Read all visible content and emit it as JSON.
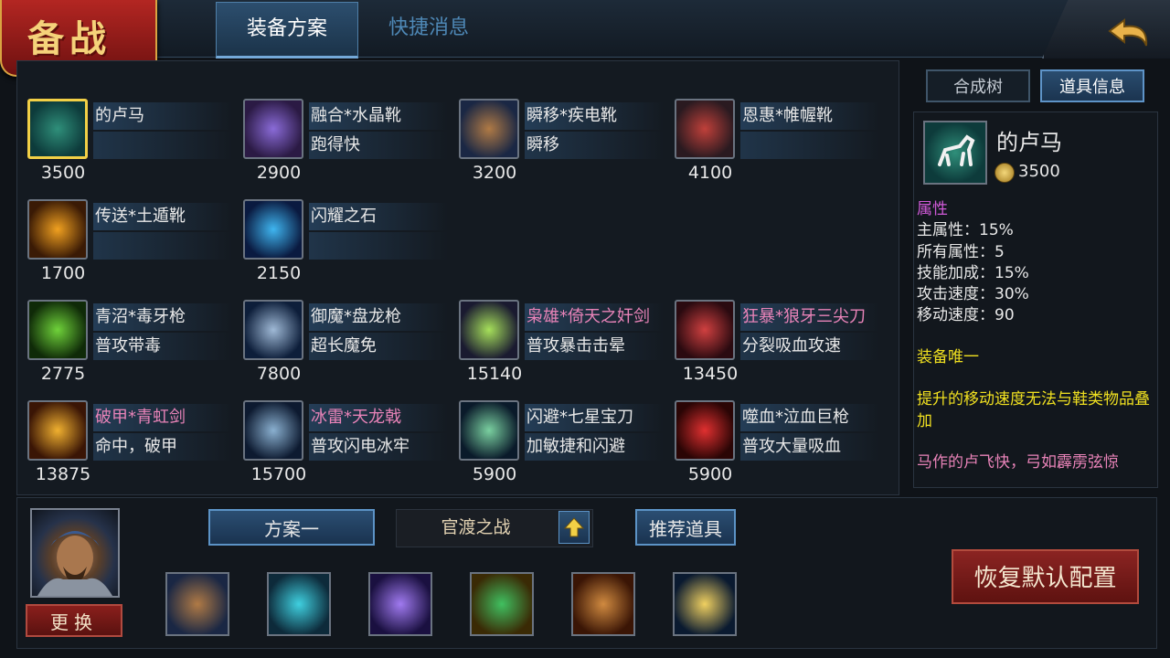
{
  "header": {
    "title": "备战",
    "tabs": [
      "装备方案",
      "快捷消息"
    ]
  },
  "items": [
    {
      "name": "的卢马",
      "desc": "",
      "price": "3500",
      "pink": false,
      "selected": true,
      "icon": "horse-icon",
      "colors": [
        "#0d3b3b",
        "#2f8f7a"
      ]
    },
    {
      "name": "融合*水晶靴",
      "desc": "跑得快",
      "price": "2900",
      "pink": false,
      "selected": false,
      "icon": "crystal-boots-icon",
      "colors": [
        "#2b1a44",
        "#8a6bd8"
      ]
    },
    {
      "name": "瞬移*疾电靴",
      "desc": "瞬移",
      "price": "3200",
      "pink": false,
      "selected": false,
      "icon": "lightning-boots-icon",
      "colors": [
        "#1a2744",
        "#b07a45"
      ]
    },
    {
      "name": "恩惠*帷幄靴",
      "desc": "",
      "price": "4100",
      "pink": false,
      "selected": false,
      "icon": "red-boots-icon",
      "colors": [
        "#2a1a20",
        "#c0403a"
      ]
    },
    {
      "name": "传送*土遁靴",
      "desc": "",
      "price": "1700",
      "pink": false,
      "selected": false,
      "icon": "fire-boots-icon",
      "colors": [
        "#3a1a05",
        "#f0a020"
      ]
    },
    {
      "name": "闪耀之石",
      "desc": "",
      "price": "2150",
      "pink": false,
      "selected": false,
      "icon": "blue-gem-icon",
      "colors": [
        "#0a1a40",
        "#3fb5f0"
      ]
    },
    {
      "name": "青沼*毒牙枪",
      "desc": "普攻带毒",
      "price": "2775",
      "pink": false,
      "selected": false,
      "icon": "poison-spear-icon",
      "colors": [
        "#0f2a08",
        "#6fd23a"
      ]
    },
    {
      "name": "御魔*盘龙枪",
      "desc": "超长魔免",
      "price": "7800",
      "pink": false,
      "selected": false,
      "icon": "dragon-spear-icon",
      "colors": [
        "#0d1e3a",
        "#9fb9d6"
      ]
    },
    {
      "name": "枭雄*倚天之奸剑",
      "desc": "普攻暴击击晕",
      "price": "15140",
      "pink": true,
      "selected": false,
      "icon": "green-sword-icon",
      "colors": [
        "#1a1a30",
        "#a6e05a"
      ]
    },
    {
      "name": "狂暴*狼牙三尖刀",
      "desc": "分裂吸血攻速",
      "price": "13450",
      "pink": true,
      "selected": false,
      "icon": "trident-blade-icon",
      "colors": [
        "#2a0a10",
        "#d04040"
      ]
    },
    {
      "name": "破甲*青虹剑",
      "desc": "命中，破甲",
      "price": "13875",
      "pink": true,
      "selected": false,
      "icon": "golden-sword-icon",
      "colors": [
        "#3a1505",
        "#f0b030"
      ]
    },
    {
      "name": "冰雷*天龙戟",
      "desc": "普攻闪电冰牢",
      "price": "15700",
      "pink": true,
      "selected": false,
      "icon": "halberd-icon",
      "colors": [
        "#0d1a30",
        "#8ab0d0"
      ]
    },
    {
      "name": "闪避*七星宝刀",
      "desc": "加敏捷和闪避",
      "price": "5900",
      "pink": false,
      "selected": false,
      "icon": "seven-star-blade-icon",
      "colors": [
        "#0a1a2a",
        "#7ad0a0"
      ]
    },
    {
      "name": "噬血*泣血巨枪",
      "desc": "普攻大量吸血",
      "price": "5900",
      "pink": false,
      "selected": false,
      "icon": "blood-spear-icon",
      "colors": [
        "#2a0505",
        "#e03030"
      ]
    }
  ],
  "right": {
    "tabs": {
      "tree": "合成树",
      "info": "道具信息"
    },
    "detail": {
      "name": "的卢马",
      "price": "3500",
      "attr_title": "属性",
      "attrs": [
        "主属性：15%",
        "所有属性：5",
        "技能加成：15%",
        "攻击速度：30%",
        "移动速度：90"
      ],
      "unique": "装备唯一",
      "note_line1": "提升的移动速度无法与鞋类物品叠",
      "note_line2": "加",
      "flavor": "马作的卢飞快，弓如霹雳弦惊"
    }
  },
  "bottom": {
    "change": "更换",
    "plan": "方案一",
    "map": "官渡之战",
    "recommend": "推荐道具",
    "restore": "恢复默认配置",
    "slots": [
      {
        "icon": "boots-slot-icon",
        "colors": [
          "#1a2744",
          "#b07a45"
        ]
      },
      {
        "icon": "crystal-armor-slot-icon",
        "colors": [
          "#0d2a3a",
          "#3fd0e0"
        ]
      },
      {
        "icon": "purple-shield-slot-icon",
        "colors": [
          "#1a1040",
          "#a07af0"
        ]
      },
      {
        "icon": "green-seal-slot-icon",
        "colors": [
          "#3a2a05",
          "#40c060"
        ]
      },
      {
        "icon": "scale-armor-slot-icon",
        "colors": [
          "#3a1505",
          "#d08a40"
        ]
      },
      {
        "icon": "golden-blade-slot-icon",
        "colors": [
          "#0a1a30",
          "#f0d060"
        ]
      }
    ]
  },
  "colors": {
    "pink": "#e883b8",
    "attr_purple": "#d05ad8",
    "yellow": "#f0e020",
    "gold_border": "#f2d046"
  }
}
